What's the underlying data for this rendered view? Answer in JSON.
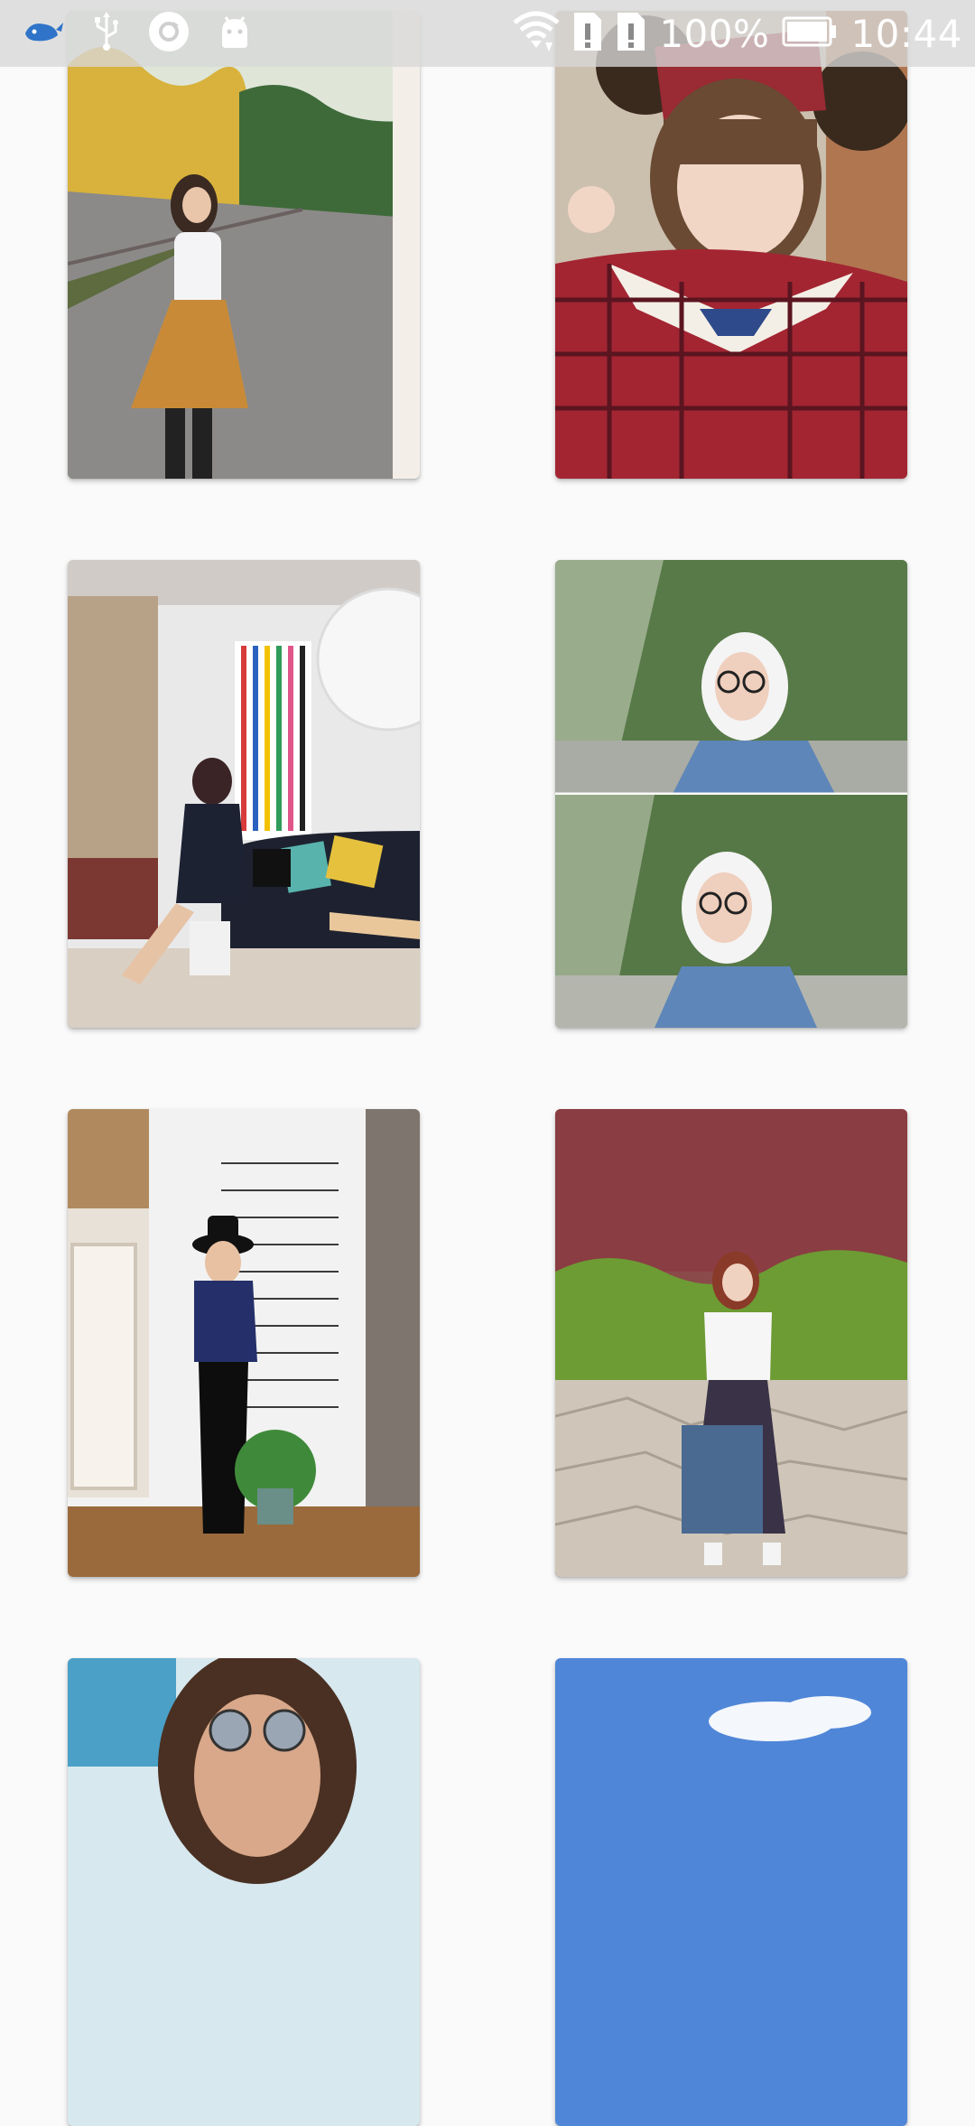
{
  "status_bar": {
    "battery_percent": "100%",
    "battery_level": 1.0,
    "time": "10:44",
    "left_icons": [
      "whale-app-icon",
      "usb-icon",
      "sync-icon",
      "android-debug-icon"
    ],
    "right_icons": [
      "wifi-icon",
      "sim1-alert-icon",
      "sim2-alert-icon",
      "battery-icon"
    ]
  },
  "gallery": {
    "columns": 2,
    "items": [
      {
        "photo": "girl-orange-skirt-on-road"
      },
      {
        "photo": "girl-red-plaid-bear-ears"
      },
      {
        "photo": "girl-in-living-room"
      },
      {
        "photo": "girl-white-hood-glasses-collage"
      },
      {
        "photo": "girl-black-hat-white-wall"
      },
      {
        "photo": "girl-striped-skirt-tote-bag"
      },
      {
        "photo": "girl-sunglasses-partial"
      },
      {
        "photo": "blue-sky-partial"
      }
    ]
  }
}
